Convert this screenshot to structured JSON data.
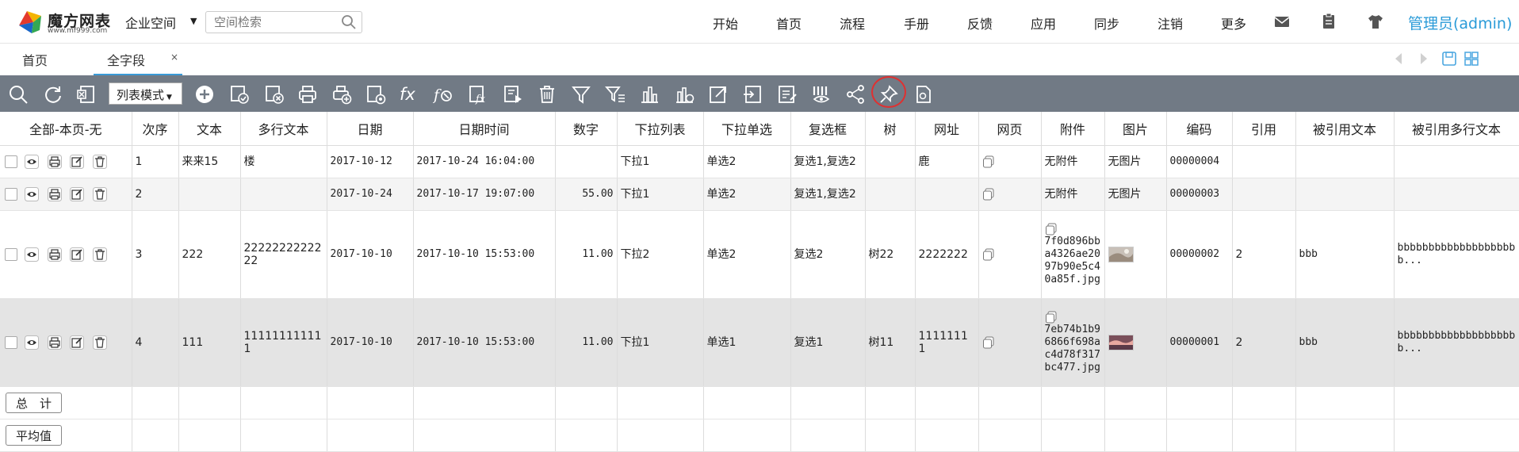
{
  "header": {
    "brand": "魔方网表",
    "site": "www.mf999.com",
    "space": "企业空间",
    "search_placeholder": "空间检索",
    "nav": [
      "开始",
      "首页",
      "流程",
      "手册",
      "反馈",
      "应用",
      "同步",
      "注销",
      "更多"
    ],
    "admin": "管理员(admin)"
  },
  "tabs": {
    "home": "首页",
    "active": "全字段",
    "close": "×"
  },
  "toolbar": {
    "mode": "列表模式",
    "icons": [
      "search-icon",
      "refresh-icon",
      "excel-icon",
      "add-icon",
      "approve-icon",
      "cancel-approve-icon",
      "print-icon",
      "print-add-icon",
      "print-setting-icon",
      "formula-icon",
      "formula-clear-icon",
      "function-icon",
      "run-icon",
      "delete-icon",
      "filter-icon",
      "filter-advanced-icon",
      "bar-chart-icon",
      "chart-icon",
      "export-icon",
      "import-icon",
      "edit-batch-icon",
      "view-column-icon",
      "share-icon",
      "pin-icon",
      "document-icon"
    ],
    "accent": "#717a85",
    "highlight_color": "#e03030"
  },
  "columns": [
    "全部-本页-无",
    "次序",
    "文本",
    "多行文本",
    "日期",
    "日期时间",
    "数字",
    "下拉列表",
    "下拉单选",
    "复选框",
    "树",
    "网址",
    "网页",
    "附件",
    "图片",
    "编码",
    "引用",
    "被引用文本",
    "被引用多行文本"
  ],
  "rows": [
    {
      "seq": "1",
      "text": "来来15",
      "multi": "楼",
      "date": "2017-10-12",
      "datetime": "2017-10-24 16:04:00",
      "num": "",
      "dropdown": "下拉1",
      "single": "单选2",
      "check": "复选1,复选2",
      "tree": "",
      "url": "鹿",
      "attach": "无附件",
      "image": "无图片",
      "code": "00000004",
      "ref": "",
      "reftext": "",
      "refmulti": ""
    },
    {
      "seq": "2",
      "text": "",
      "multi": "",
      "date": "2017-10-24",
      "datetime": "2017-10-17 19:07:00",
      "num": "55.00",
      "dropdown": "下拉1",
      "single": "单选2",
      "check": "复选1,复选2",
      "tree": "",
      "url": "",
      "attach": "无附件",
      "image": "无图片",
      "code": "00000003",
      "ref": "",
      "reftext": "",
      "refmulti": ""
    },
    {
      "seq": "3",
      "text": "222",
      "multi": "2222222222222",
      "date": "2017-10-10",
      "datetime": "2017-10-10 15:53:00",
      "num": "11.00",
      "dropdown": "下拉2",
      "single": "单选2",
      "check": "复选2",
      "tree": "树22",
      "url": "2222222",
      "attach": "7f0d896bba4326ae2097b90e5c40a85f.jpg",
      "image": "",
      "code": "00000002",
      "ref": "2",
      "reftext": "bbb",
      "refmulti": "bbbbbbbbbbbbbbbbbbbb..."
    },
    {
      "seq": "4",
      "text": "111",
      "multi": "111111111111",
      "date": "2017-10-10",
      "datetime": "2017-10-10 15:53:00",
      "num": "11.00",
      "dropdown": "下拉1",
      "single": "单选1",
      "check": "复选1",
      "tree": "树11",
      "url": "11111111",
      "attach": "7eb74b1b96866f698ac4d78f317bc477.jpg",
      "image": "",
      "code": "00000001",
      "ref": "2",
      "reftext": "bbb",
      "refmulti": "bbbbbbbbbbbbbbbbbbbb..."
    }
  ],
  "footer": {
    "total": "总　计",
    "average": "平均值"
  }
}
